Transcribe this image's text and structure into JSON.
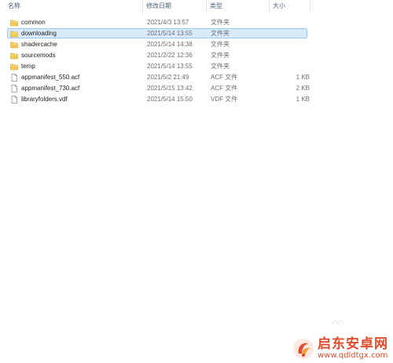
{
  "columns": {
    "name": "名称",
    "date": "修改日期",
    "type": "类型",
    "size": "大小"
  },
  "files": [
    {
      "name": "common",
      "date": "2021/4/3 13:57",
      "type": "文件夹",
      "size": "",
      "icon": "folder-icon",
      "selected": false
    },
    {
      "name": "downloading",
      "date": "2021/5/14 13:55",
      "type": "文件夹",
      "size": "",
      "icon": "folder-icon",
      "selected": true
    },
    {
      "name": "shadercache",
      "date": "2021/5/14 14:38",
      "type": "文件夹",
      "size": "",
      "icon": "folder-icon",
      "selected": false
    },
    {
      "name": "sourcemods",
      "date": "2021/2/22 12:36",
      "type": "文件夹",
      "size": "",
      "icon": "folder-icon",
      "selected": false
    },
    {
      "name": "temp",
      "date": "2021/5/14 13:55",
      "type": "文件夹",
      "size": "",
      "icon": "folder-icon",
      "selected": false
    },
    {
      "name": "appmanifest_550.acf",
      "date": "2021/5/2 21:49",
      "type": "ACF 文件",
      "size": "1 KB",
      "icon": "file-icon",
      "selected": false
    },
    {
      "name": "appmanifest_730.acf",
      "date": "2021/5/15 13:42",
      "type": "ACF 文件",
      "size": "2 KB",
      "icon": "file-icon",
      "selected": false
    },
    {
      "name": "libraryfolders.vdf",
      "date": "2021/5/14 15:50",
      "type": "VDF 文件",
      "size": "1 KB",
      "icon": "file-icon",
      "selected": false
    }
  ],
  "watermark": {
    "title": "启东安卓网",
    "url": "www.qdldtgx.com",
    "icon": "watermark-logo-icon"
  },
  "colors": {
    "header_text": "#4c607a",
    "selection_bg": "#d9ebfb",
    "selection_border": "#99c8f3",
    "folder": "#f2c955",
    "watermark": "#e04b2c"
  }
}
